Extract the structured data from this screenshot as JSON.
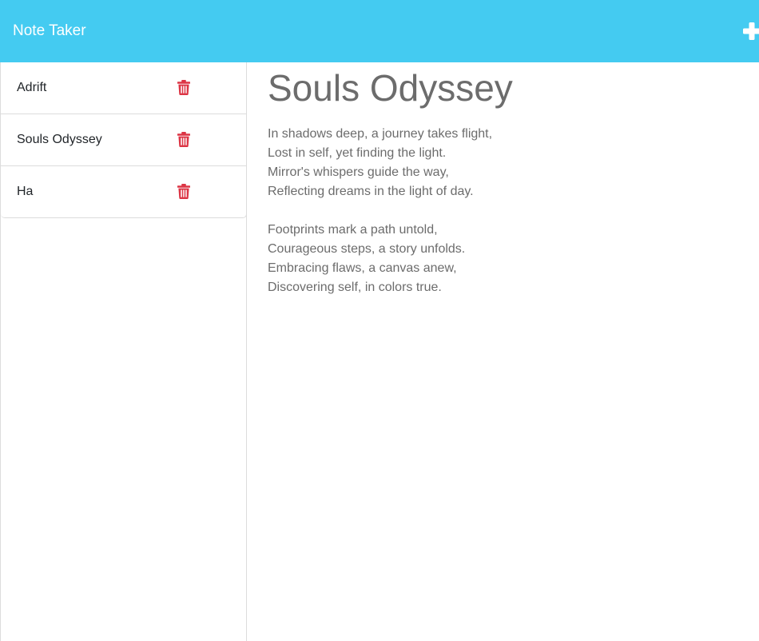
{
  "navbar": {
    "brand": "Note Taker",
    "add_icon": "plus-icon",
    "color": "#44cbf1"
  },
  "notes": [
    {
      "title": "Adrift",
      "delete_icon": "trash-icon"
    },
    {
      "title": "Souls Odyssey",
      "delete_icon": "trash-icon"
    },
    {
      "title": "Ha",
      "delete_icon": "trash-icon"
    }
  ],
  "active_note": {
    "title": "Souls Odyssey",
    "text": "In shadows deep, a journey takes flight,\nLost in self, yet finding the light.\nMirror's whispers guide the way,\nReflecting dreams in the light of day.\n\nFootprints mark a path untold,\nCourageous steps, a story unfolds.\nEmbracing flaws, a canvas anew,\nDiscovering self, in colors true."
  },
  "colors": {
    "delete": "#dc3545",
    "muted_text": "#6c6c6c"
  }
}
